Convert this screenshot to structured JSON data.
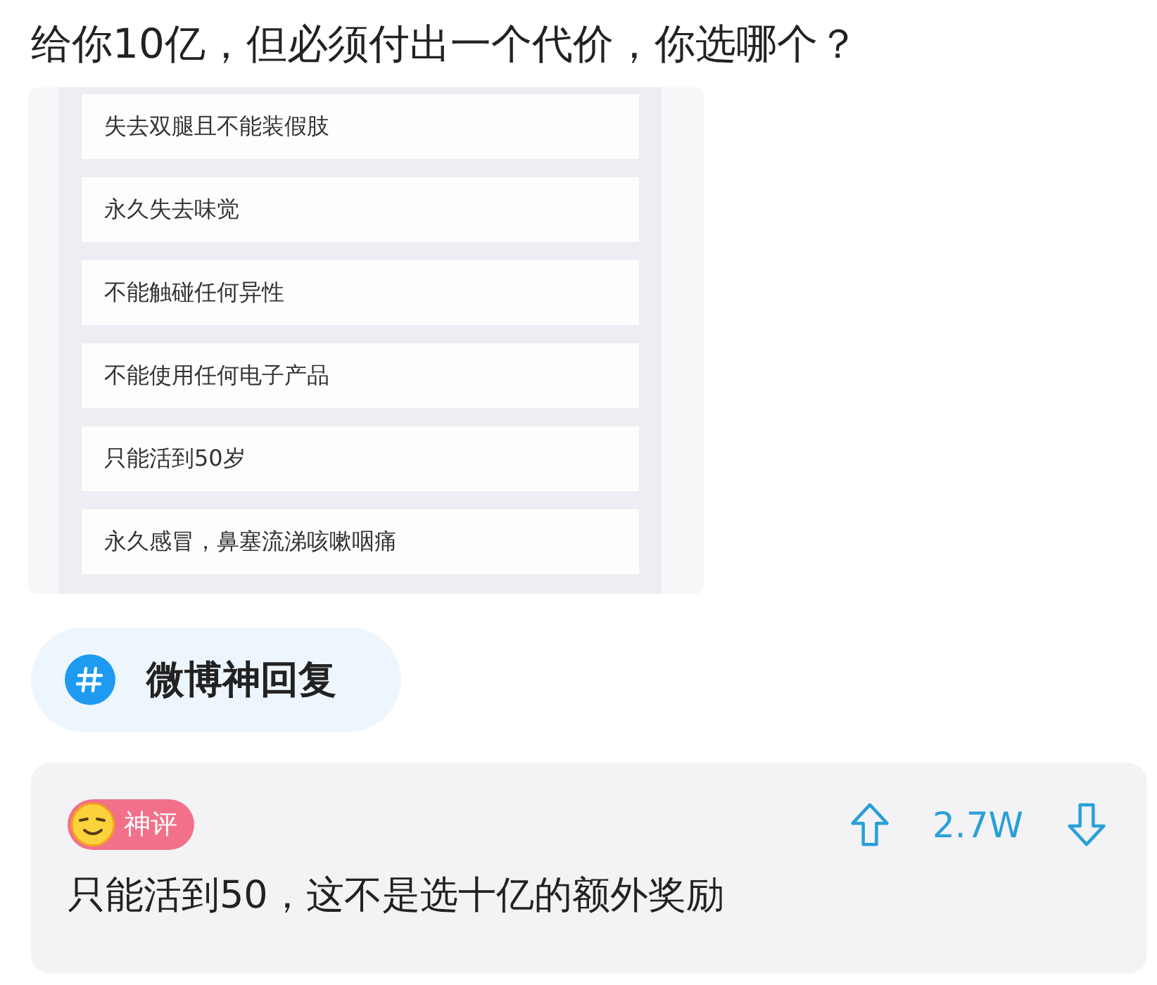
{
  "post_title": "给你10亿，但必须付出一个代价，你选哪个？",
  "options": [
    "失去双腿且不能装假肢",
    "永久失去味觉",
    "不能触碰任何异性",
    "不能使用任何电子产品",
    "只能活到50岁",
    "永久感冒，鼻塞流涕咳嗽咽痛"
  ],
  "topic": {
    "label": "微博神回复"
  },
  "comment": {
    "badge": "神评",
    "votes": "2.7W",
    "text": "只能活到50，这不是选十亿的额外奖励"
  }
}
